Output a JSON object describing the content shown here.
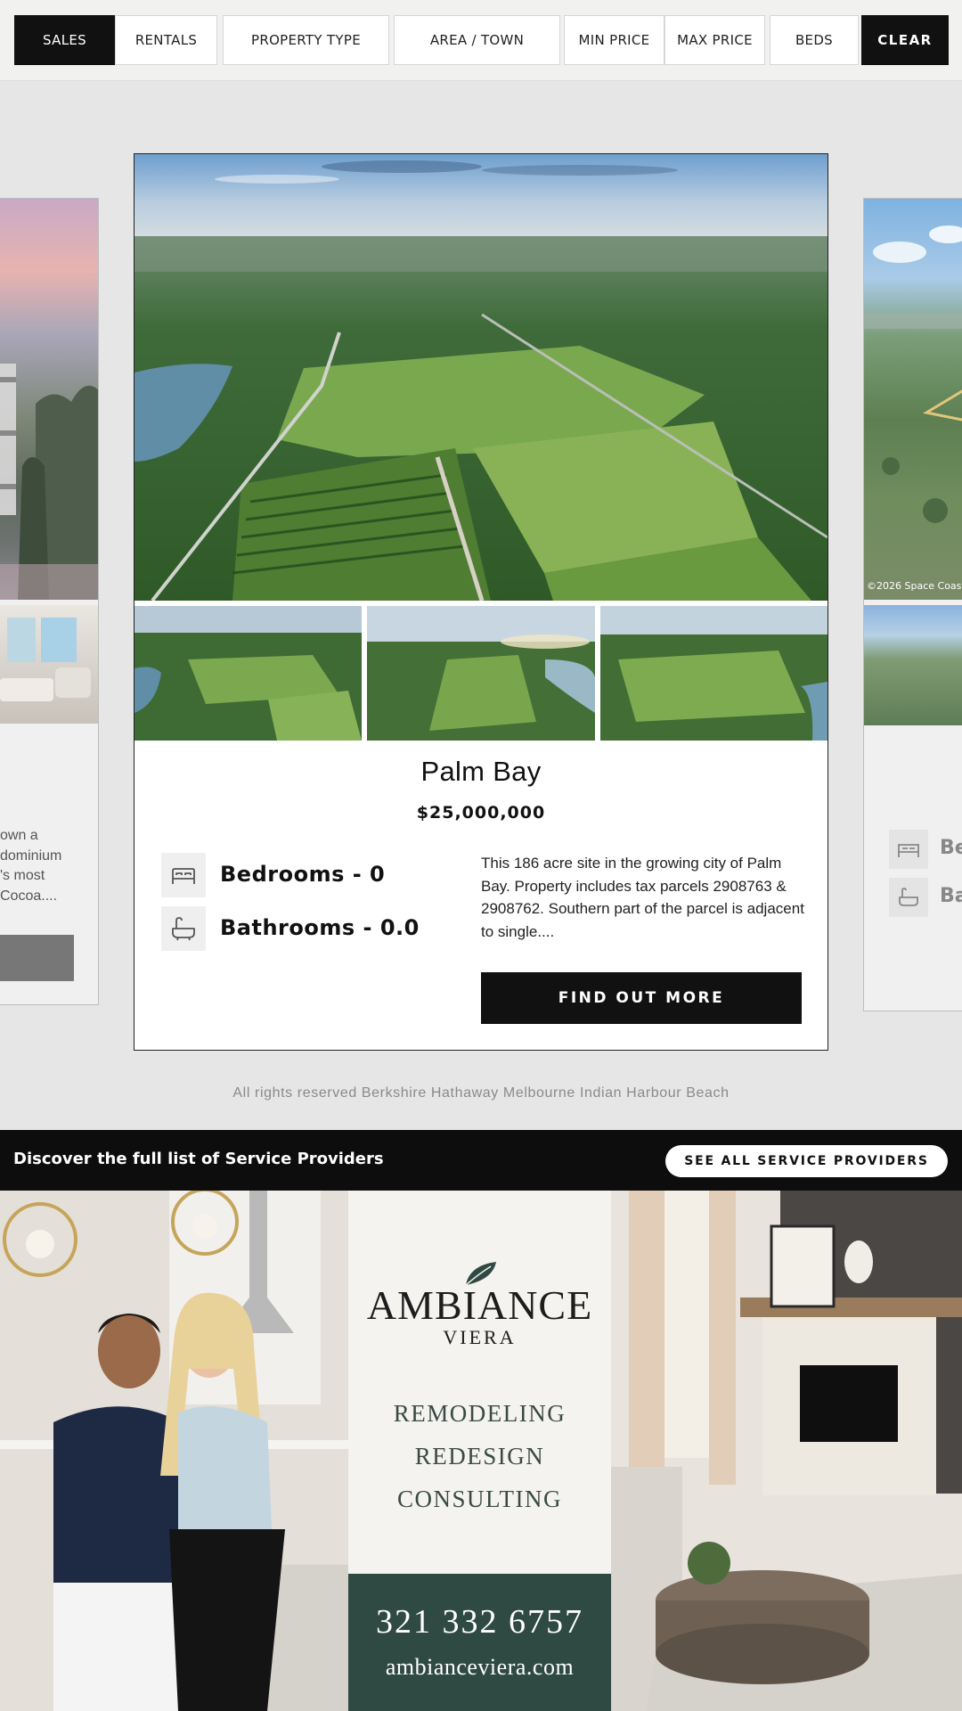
{
  "filters": {
    "sales": "SALES",
    "rentals": "RENTALS",
    "property_type": "PROPERTY TYPE",
    "area_town": "AREA / TOWN",
    "min_price": "MIN PRICE",
    "max_price": "MAX PRICE",
    "beds": "BEDS",
    "clear": "CLEAR",
    "active": "SALES"
  },
  "left_card": {
    "description_fragment": [
      " own a",
      "dominium",
      "'s most",
      "Cocoa...."
    ]
  },
  "listing": {
    "town": "Palm Bay",
    "price": "$25,000,000",
    "bedrooms": "Bedrooms - 0",
    "bathrooms": "Bathrooms - 0.0",
    "description": "This 186 acre site in the growing city of Palm Bay. Property includes tax parcels 2908763 & 2908762. Southern part of the parcel is adjacent to single....",
    "cta": "FIND OUT MORE",
    "thumbnail_count": 3
  },
  "right_card": {
    "photo_credit": "©2026 Space Coast",
    "bedrooms_fragment": "Be",
    "bathrooms_fragment": "Ba"
  },
  "footer": {
    "rights": "All rights reserved Berkshire Hathaway Melbourne Indian Harbour Beach"
  },
  "service_providers": {
    "text": "Discover the full list of Service Providers",
    "button": "SEE ALL SERVICE PROVIDERS"
  },
  "ad": {
    "brand": "AMBIANCE",
    "sub_brand": "VIERA",
    "services": [
      "REMODELING",
      "REDESIGN",
      "CONSULTING"
    ],
    "phone": "321 332 6757",
    "website": "ambianceviera.com"
  },
  "colors": {
    "primary_dark": "#111111",
    "ad_green": "#2f4a42",
    "page_background": "#e6e6e6"
  }
}
